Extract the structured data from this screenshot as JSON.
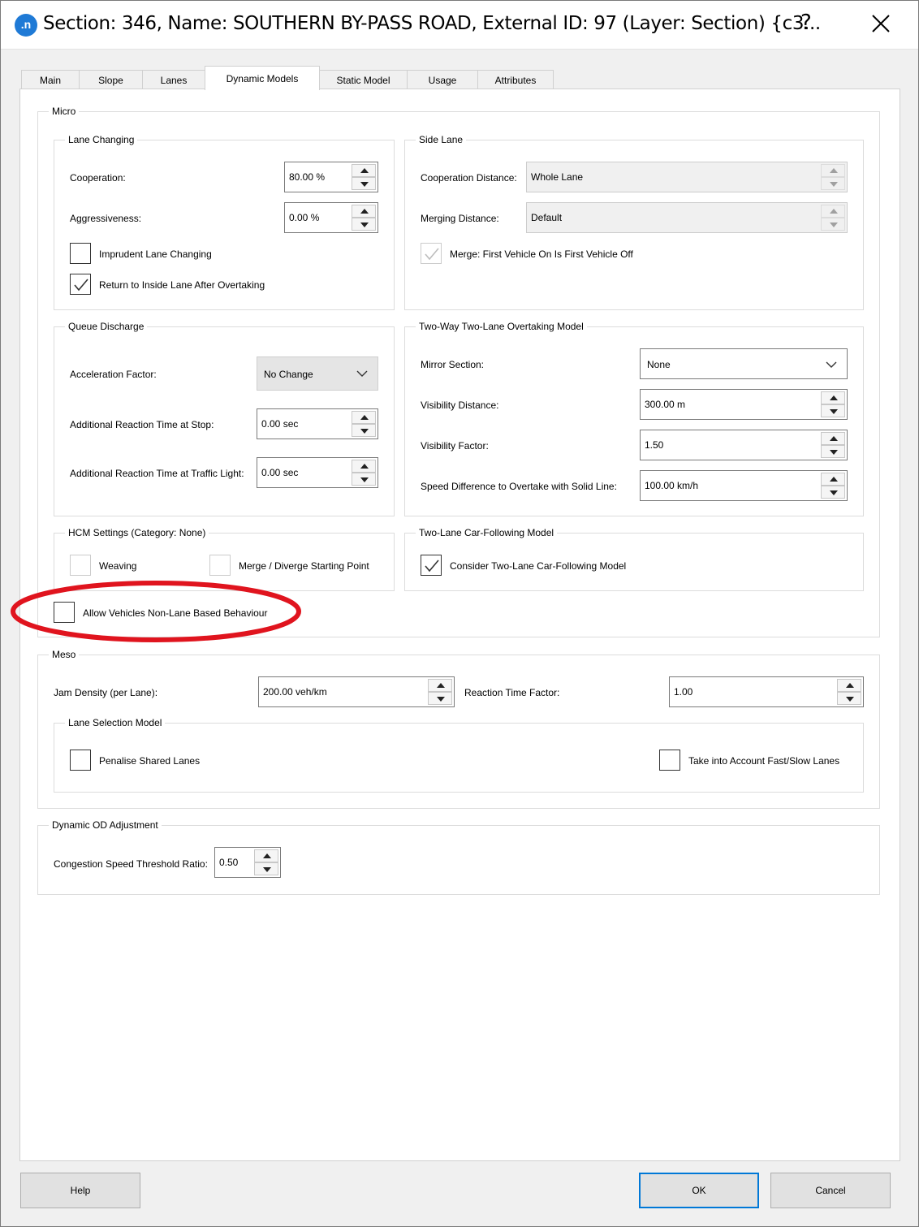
{
  "window": {
    "app_icon": ".n",
    "title": "Section: 346, Name: SOUTHERN BY-PASS ROAD, External ID: 97 (Layer: Section) {c3...",
    "help_glyph": "?",
    "close_icon": "close-icon"
  },
  "tabs": [
    {
      "label": "Main",
      "active": false
    },
    {
      "label": "Slope",
      "active": false
    },
    {
      "label": "Lanes",
      "active": false
    },
    {
      "label": "Dynamic Models",
      "active": true
    },
    {
      "label": "Static Model",
      "active": false
    },
    {
      "label": "Usage",
      "active": false
    },
    {
      "label": "Attributes",
      "active": false
    }
  ],
  "micro": {
    "title": "Micro",
    "lane_changing": {
      "title": "Lane Changing",
      "cooperation_label": "Cooperation:",
      "cooperation_value": "80.00 %",
      "aggressiveness_label": "Aggressiveness:",
      "aggressiveness_value": "0.00 %",
      "imprudent_label": "Imprudent Lane Changing",
      "imprudent_checked": false,
      "return_inside_label": "Return to Inside Lane After Overtaking",
      "return_inside_checked": true
    },
    "side_lane": {
      "title": "Side Lane",
      "coop_distance_label": "Cooperation Distance:",
      "coop_distance_value": "Whole Lane",
      "merging_distance_label": "Merging Distance:",
      "merging_distance_value": "Default",
      "merge_label": "Merge: First Vehicle On Is First Vehicle Off",
      "merge_checked": true,
      "merge_disabled": true
    },
    "queue_discharge": {
      "title": "Queue Discharge",
      "accel_label": "Acceleration Factor:",
      "accel_value": "No Change",
      "reaction_stop_label": "Additional Reaction Time at Stop:",
      "reaction_stop_value": "0.00 sec",
      "reaction_light_label": "Additional Reaction Time at Traffic Light:",
      "reaction_light_value": "0.00 sec"
    },
    "overtaking": {
      "title": "Two-Way Two-Lane Overtaking Model",
      "mirror_label": "Mirror Section:",
      "mirror_value": "None",
      "visibility_distance_label": "Visibility Distance:",
      "visibility_distance_value": "300.00 m",
      "visibility_factor_label": "Visibility Factor:",
      "visibility_factor_value": "1.50",
      "speed_diff_label": "Speed Difference to Overtake with Solid Line:",
      "speed_diff_value": "100.00 km/h"
    },
    "hcm": {
      "title": "HCM Settings (Category: None)",
      "weaving_label": "Weaving",
      "merge_diverge_label": "Merge / Diverge Starting Point"
    },
    "car_following": {
      "title": "Two-Lane Car-Following Model",
      "consider_label": "Consider Two-Lane Car-Following Model",
      "consider_checked": true
    },
    "non_lane_label": "Allow Vehicles Non-Lane Based Behaviour",
    "non_lane_checked": false
  },
  "meso": {
    "title": "Meso",
    "jam_density_label": "Jam Density (per Lane):",
    "jam_density_value": "200.00 veh/km",
    "reaction_factor_label": "Reaction Time Factor:",
    "reaction_factor_value": "1.00",
    "lane_selection": {
      "title": "Lane Selection Model",
      "penalise_label": "Penalise Shared Lanes",
      "fast_slow_label": "Take into Account Fast/Slow Lanes"
    }
  },
  "od_adjustment": {
    "title": "Dynamic OD Adjustment",
    "congestion_label": "Congestion Speed Threshold Ratio:",
    "congestion_value": "0.50"
  },
  "buttons": {
    "help": "Help",
    "ok": "OK",
    "cancel": "Cancel"
  },
  "colors": {
    "app_icon": "#1f7ad6",
    "highlight_annotation": "#e0141e",
    "default_button_border": "#0078d7"
  }
}
